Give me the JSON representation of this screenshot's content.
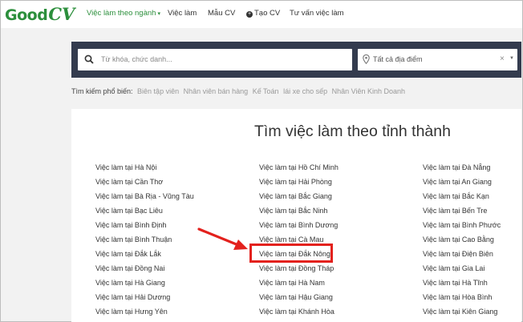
{
  "header": {
    "logo_good": "Good",
    "logo_cv": "CV",
    "nav": [
      {
        "label": "Việc làm theo ngành",
        "active": true
      },
      {
        "label": "Việc làm"
      },
      {
        "label": "Mẫu CV"
      },
      {
        "label": "Tạo CV"
      },
      {
        "label": "Tư vấn việc làm"
      }
    ]
  },
  "search": {
    "placeholder": "Từ khóa, chức danh...",
    "location": "Tất cả địa điểm"
  },
  "popular": {
    "label": "Tìm kiếm phổ biến:",
    "tags": [
      "Biên tập viên",
      "Nhân viên bán hàng",
      "Kế Toán",
      "lái xe cho sếp",
      "Nhân Viên Kinh Doanh"
    ]
  },
  "main": {
    "title": "Tìm việc làm theo tỉnh thành",
    "col1": [
      "Việc làm tại Hà Nội",
      "Việc làm tại Cần Thơ",
      "Việc làm tại Bà Rịa - Vũng Tàu",
      "Việc làm tại Bạc Liêu",
      "Việc làm tại Bình Định",
      "Việc làm tại Bình Thuận",
      "Việc làm tại Đắk Lắk",
      "Việc làm tại Đồng Nai",
      "Việc làm tại Hà Giang",
      "Việc làm tại Hải Dương",
      "Việc làm tại Hưng Yên"
    ],
    "col2": [
      "Việc làm tại Hồ Chí Minh",
      "Việc làm tại Hải Phòng",
      "Việc làm tại Bắc Giang",
      "Việc làm tại Bắc Ninh",
      "Việc làm tại Bình Dương",
      "Việc làm tại Cà Mau",
      "Việc làm tại Đắk Nông",
      "Việc làm tại Đồng Tháp",
      "Việc làm tại Hà Nam",
      "Việc làm tại Hậu Giang",
      "Việc làm tại Khánh Hòa"
    ],
    "col3": [
      "Việc làm tại Đà Nẵng",
      "Việc làm tại An Giang",
      "Việc làm tại Bắc Kạn",
      "Việc làm tại Bến Tre",
      "Việc làm tại Bình Phước",
      "Việc làm tại Cao Bằng",
      "Việc làm tại Điện Biên",
      "Việc làm tại Gia Lai",
      "Việc làm tại Hà Tĩnh",
      "Việc làm tại Hòa Bình",
      "Việc làm tại Kiên Giang"
    ]
  },
  "annotation": {
    "highlight_color": "#e3211d"
  }
}
